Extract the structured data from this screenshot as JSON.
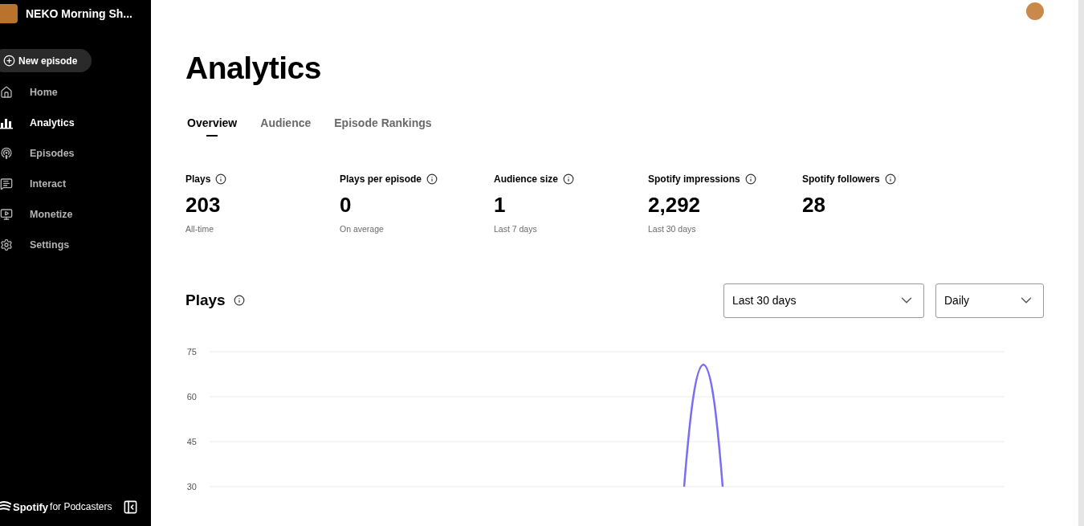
{
  "sidebar": {
    "show_title": "NEKO Morning Sh...",
    "new_episode": "New episode",
    "items": [
      {
        "label": "Home",
        "selected": false
      },
      {
        "label": "Analytics",
        "selected": true
      },
      {
        "label": "Episodes",
        "selected": false
      },
      {
        "label": "Interact",
        "selected": false
      },
      {
        "label": "Monetize",
        "selected": false
      },
      {
        "label": "Settings",
        "selected": false
      }
    ],
    "brand": {
      "name": "Spotify",
      "suffix": "for Podcasters"
    }
  },
  "page": {
    "title": "Analytics"
  },
  "tabs": [
    {
      "label": "Overview",
      "selected": true
    },
    {
      "label": "Audience",
      "selected": false
    },
    {
      "label": "Episode Rankings",
      "selected": false
    }
  ],
  "stats": [
    {
      "label": "Plays",
      "value": "203",
      "note": "All-time"
    },
    {
      "label": "Plays per episode",
      "value": "0",
      "note": "On average"
    },
    {
      "label": "Audience size",
      "value": "1",
      "note": "Last 7 days"
    },
    {
      "label": "Spotify impressions",
      "value": "2,292",
      "note": "Last 30 days"
    },
    {
      "label": "Spotify followers",
      "value": "28"
    }
  ],
  "plays": {
    "title": "Plays",
    "range": "Last 30 days",
    "interval": "Daily",
    "axis_labels": [
      "75",
      "60",
      "45",
      "30"
    ]
  }
}
